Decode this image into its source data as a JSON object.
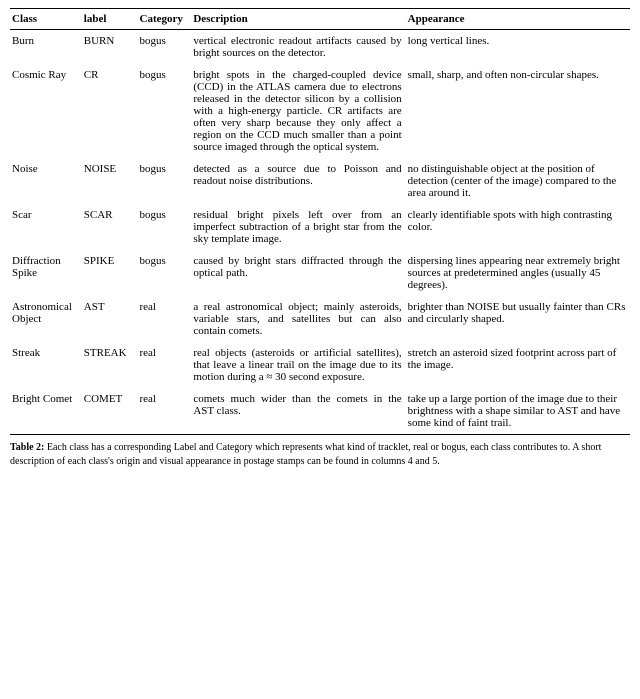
{
  "table": {
    "headers": {
      "class": "Class",
      "label": "label",
      "category": "Category",
      "description": "Description",
      "appearance": "Appearance"
    },
    "rows": [
      {
        "class": "Burn",
        "label": "BURN",
        "category": "bogus",
        "description": "vertical electronic readout artifacts caused by bright sources on the detector.",
        "appearance": "long vertical lines."
      },
      {
        "class": "Cosmic Ray",
        "label": "CR",
        "category": "bogus",
        "description": "bright spots in the charged-coupled device (CCD) in the ATLAS camera due to electrons released in the detector silicon by a collision with a high-energy particle.  CR artifacts are often very sharp because they only affect a region on the CCD much smaller than a point source imaged through the optical system.",
        "appearance": "small, sharp, and often non-circular shapes."
      },
      {
        "class": "Noise",
        "label": "NOISE",
        "category": "bogus",
        "description": "detected as a source due to Poisson and readout noise distributions.",
        "appearance": "no distinguishable object at the position of detection (center of the image) compared to the area around it."
      },
      {
        "class": "Scar",
        "label": "SCAR",
        "category": "bogus",
        "description": "residual bright pixels left over from an imperfect subtraction of a bright star from the sky template image.",
        "appearance": "clearly identifiable spots with high contrasting color."
      },
      {
        "class": "Diffraction Spike",
        "label": "SPIKE",
        "category": "bogus",
        "description": "caused by bright stars diffracted through the optical path.",
        "appearance": "dispersing lines appearing near extremely bright sources at predetermined angles (usually 45 degrees)."
      },
      {
        "class": "Astronomical Object",
        "label": "AST",
        "category": "real",
        "description": "a real astronomical object; mainly asteroids, variable stars, and satellites but can also contain comets.",
        "appearance": "brighter than NOISE but usually fainter than CRs and circularly shaped."
      },
      {
        "class": "Streak",
        "label": "STREAK",
        "category": "real",
        "description": "real objects (asteroids or artificial satellites), that leave a linear trail on the image due to its motion during a ≈ 30 second exposure.",
        "appearance": "stretch an asteroid sized footprint across part of the image."
      },
      {
        "class": "Bright Comet",
        "label": "COMET",
        "category": "real",
        "description": "comets much wider than the comets in the AST class.",
        "appearance": "take up a large portion of the image due to their brightness with a shape similar to AST and have some kind of faint trail."
      }
    ]
  },
  "caption": {
    "label": "Table 2:",
    "text": " Each class has a corresponding Label and Category which represents what kind of tracklet, real or bogus, each class contributes to. A short description of each class's origin and visual appearance in postage stamps can be found in columns 4 and 5."
  }
}
